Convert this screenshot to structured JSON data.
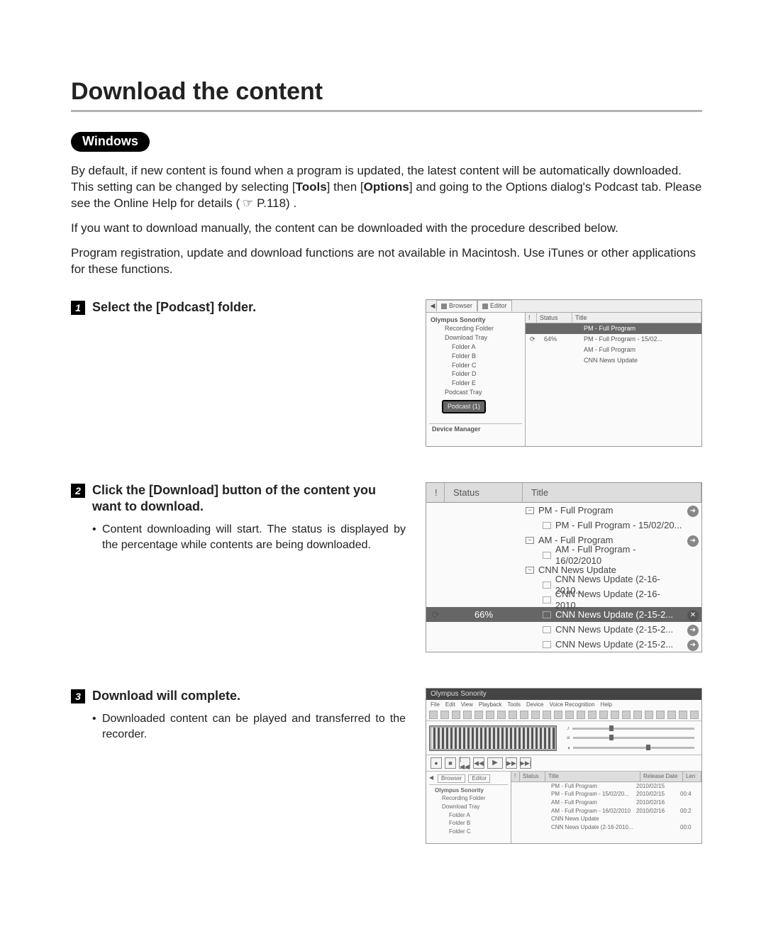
{
  "page": {
    "title": "Download the content",
    "os_label": "Windows",
    "intro_1_a": "By default, if new content is found when a program is updated, the latest content will be automatically downloaded. This setting can be changed by selecting [",
    "intro_1_b": "Tools",
    "intro_1_c": "] then [",
    "intro_1_d": "Options",
    "intro_1_e": "] and going to the Options dialog's Podcast tab.  Please see the Online Help for details (",
    "intro_1_f": "☞ P.118) .",
    "intro_2": "If you want to download manually, the content can be downloaded with the procedure described below.",
    "intro_3": "Program registration, update and download functions are not available in Macintosh. Use iTunes or other applications for these functions."
  },
  "step1": {
    "num": "1",
    "title_a": "Select the [",
    "title_b": "Podcast",
    "title_c": "] folder.",
    "shot": {
      "tabs": [
        "Browser",
        "Editor"
      ],
      "tree_root": "Olympus Sonority",
      "tree_items": [
        "Recording Folder",
        "Download Tray",
        "Folder A",
        "Folder B",
        "Folder C",
        "Folder D",
        "Folder E",
        "Podcast Tray"
      ],
      "tree_selected": "Podcast (1)",
      "tree_footer": "Device Manager",
      "list_cols": [
        "!",
        "Status",
        "Title"
      ],
      "list_rows": [
        {
          "status": "",
          "title": "PM - Full Program",
          "hl": true
        },
        {
          "status": "64%",
          "title": "PM - Full Program - 15/02..."
        },
        {
          "status": "",
          "title": "AM - Full Program"
        },
        {
          "status": "",
          "title": "CNN News Update"
        }
      ]
    }
  },
  "step2": {
    "num": "2",
    "title_a": "Click the [",
    "title_b": "Download",
    "title_c": "] button of the content you want to download.",
    "bullet": "Content downloading will start. The status is displayed by the percentage while contents are being downloaded.",
    "shot": {
      "cols": {
        "i": "!",
        "status": "Status",
        "title": "Title"
      },
      "rows": [
        {
          "type": "parent",
          "title": "PM - Full Program",
          "go": true
        },
        {
          "type": "child",
          "title": "PM - Full Program - 15/02/20..."
        },
        {
          "type": "parent",
          "title": "AM - Full Program",
          "go": true
        },
        {
          "type": "child",
          "title": "AM - Full Program - 16/02/2010"
        },
        {
          "type": "parent",
          "title": "CNN News Update"
        },
        {
          "type": "child",
          "title": "CNN News Update (2-16-2010..."
        },
        {
          "type": "child",
          "title": "CNN News Update (2-16-2010..."
        },
        {
          "type": "child",
          "status": "66%",
          "title": "CNN News Update (2-15-2...",
          "hl": true,
          "x": true
        },
        {
          "type": "child",
          "title": "CNN News Update (2-15-2...",
          "go": true
        },
        {
          "type": "child",
          "title": "CNN News Update (2-15-2...",
          "go": true
        }
      ]
    }
  },
  "step3": {
    "num": "3",
    "title": "Download will complete.",
    "bullet": "Downloaded content can be played and transferred to the recorder.",
    "shot": {
      "app_title": "Olympus Sonority",
      "menus": [
        "File",
        "Edit",
        "View",
        "Playback",
        "Tools",
        "Device",
        "Voice Recognition",
        "Help"
      ],
      "tabs": [
        "Browser",
        "Editor"
      ],
      "tree_root": "Olympus Sonority",
      "tree_items": [
        "Recording Folder",
        "Download Tray",
        "Folder A",
        "Folder B",
        "Folder C"
      ],
      "list_cols": [
        "!",
        "Status",
        "Title",
        "Release Date",
        "Len"
      ],
      "list_rows": [
        {
          "title": "PM - Full Program",
          "date": "2010/02/15",
          "len": ""
        },
        {
          "title": "PM - Full Program - 15/02/20...",
          "date": "2010/02/15",
          "len": "00:4"
        },
        {
          "title": "AM - Full Program",
          "date": "2010/02/16",
          "len": ""
        },
        {
          "title": "AM - Full Program - 16/02/2010",
          "date": "2010/02/16",
          "len": "00:2"
        },
        {
          "title": "CNN News Update",
          "date": "",
          "len": ""
        },
        {
          "title": "CNN News Update (2-16-2010...",
          "date": "",
          "len": "00:0"
        }
      ]
    }
  }
}
